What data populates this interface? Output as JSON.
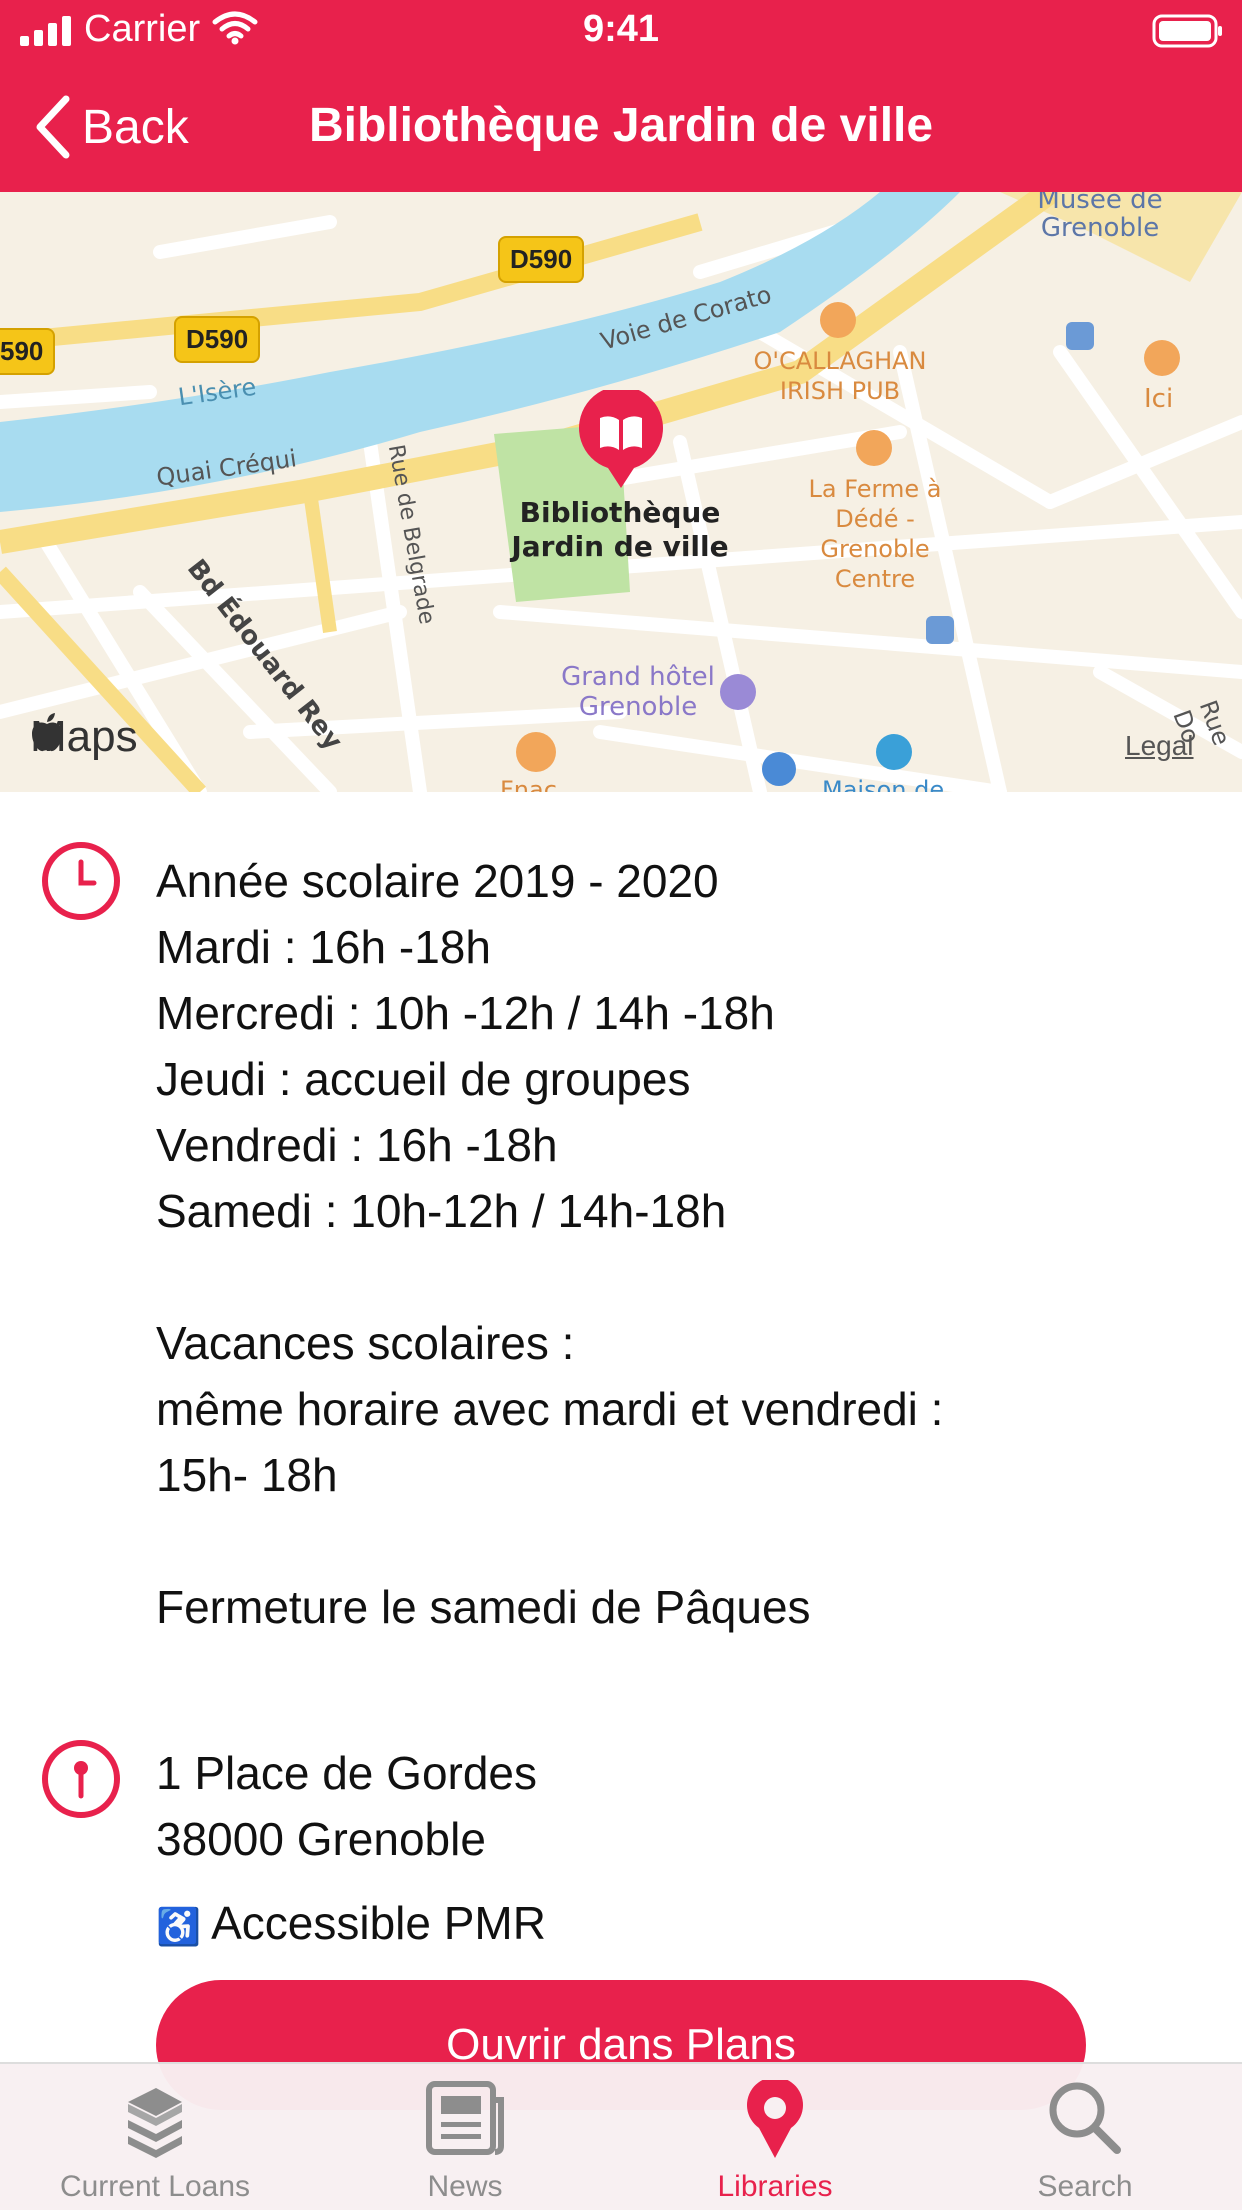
{
  "status": {
    "carrier": "Carrier",
    "time": "9:41"
  },
  "header": {
    "back_label": "Back",
    "title": "Bibliothèque Jardin de ville",
    "background": "#e8214c"
  },
  "map": {
    "labels": {
      "road1": "D590",
      "road2": "D590",
      "road3": "590",
      "river": "L'Isère",
      "quai": "Quai Créqui",
      "voie": "Voie de Corato",
      "rue": "Rue de Belgrade",
      "bd": "Bd Édouard Rey",
      "musee": "Musée de Grenoble",
      "pub": "O'CALLAGHAN IRISH PUB",
      "ferme": "La Ferme à Dédé - Grenoble Centre",
      "ici": "Ici",
      "hotel": "Grand hôtel Grenoble",
      "lib_pin": "Bibliothèque Jardin de ville",
      "bottom1": "Fnac",
      "bottom2": "Maison de",
      "maps": "Maps",
      "legal": "Legal",
      "road_right": "Rue Do"
    }
  },
  "hours": {
    "lines": [
      "Année scolaire 2019 - 2020",
      "Mardi : 16h -18h",
      "Mercredi : 10h -12h / 14h -18h",
      "Jeudi : accueil de groupes",
      "Vendredi : 16h -18h",
      "Samedi : 10h-12h / 14h-18h",
      "Vacances scolaires :",
      "même horaire avec mardi et vendredi :",
      "15h- 18h",
      "Fermeture le samedi de Pâques"
    ]
  },
  "address": {
    "line1": "1 Place de Gordes",
    "line2": "38000 Grenoble",
    "accessibility": "Accessible PMR",
    "button": "Ouvrir dans Plans"
  },
  "tabs": [
    {
      "label": "Current Loans",
      "icon": "books-icon"
    },
    {
      "label": "News",
      "icon": "newspaper-icon"
    },
    {
      "label": "Libraries",
      "icon": "map-pin-icon"
    },
    {
      "label": "Search",
      "icon": "magnifier-icon"
    }
  ],
  "active_tab": "Libraries"
}
